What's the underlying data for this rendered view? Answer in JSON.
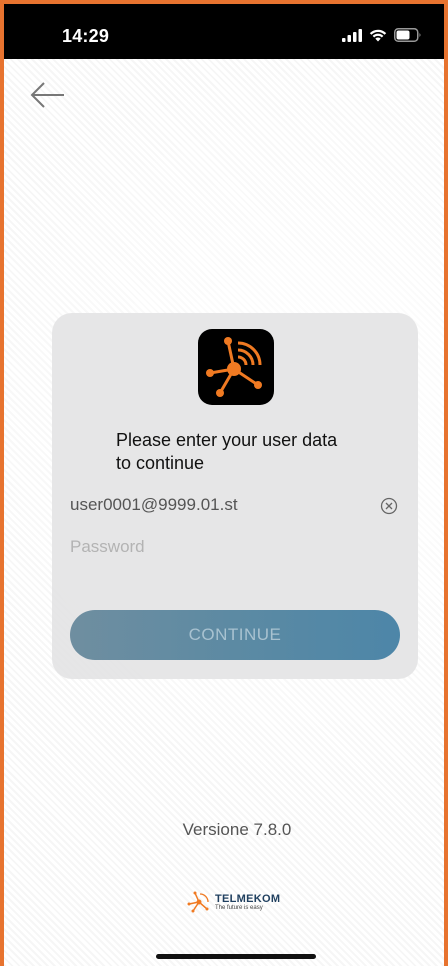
{
  "status_bar": {
    "time": "14:29",
    "icons": [
      "signal-icon",
      "wifi-icon",
      "battery-icon"
    ]
  },
  "header": {
    "back_icon": "back-arrow-icon"
  },
  "login_card": {
    "app_icon": "telmekom-app-icon",
    "prompt_line1": "Please enter your user data",
    "prompt_line2": "to continue",
    "email_value": "user0001@9999.01.st",
    "clear_icon": "clear-circle-x-icon",
    "password_placeholder": "Password",
    "continue_label": "CONTINUE"
  },
  "footer": {
    "version": "Versione 7.8.0",
    "logo_name": "TELMEKOM",
    "logo_tagline": "The future is easy"
  },
  "colors": {
    "frame_border": "#e7732f",
    "accent_orange": "#f07a22",
    "button_gradient_start": "#6f8ea0",
    "button_gradient_end": "#4d86a8"
  }
}
